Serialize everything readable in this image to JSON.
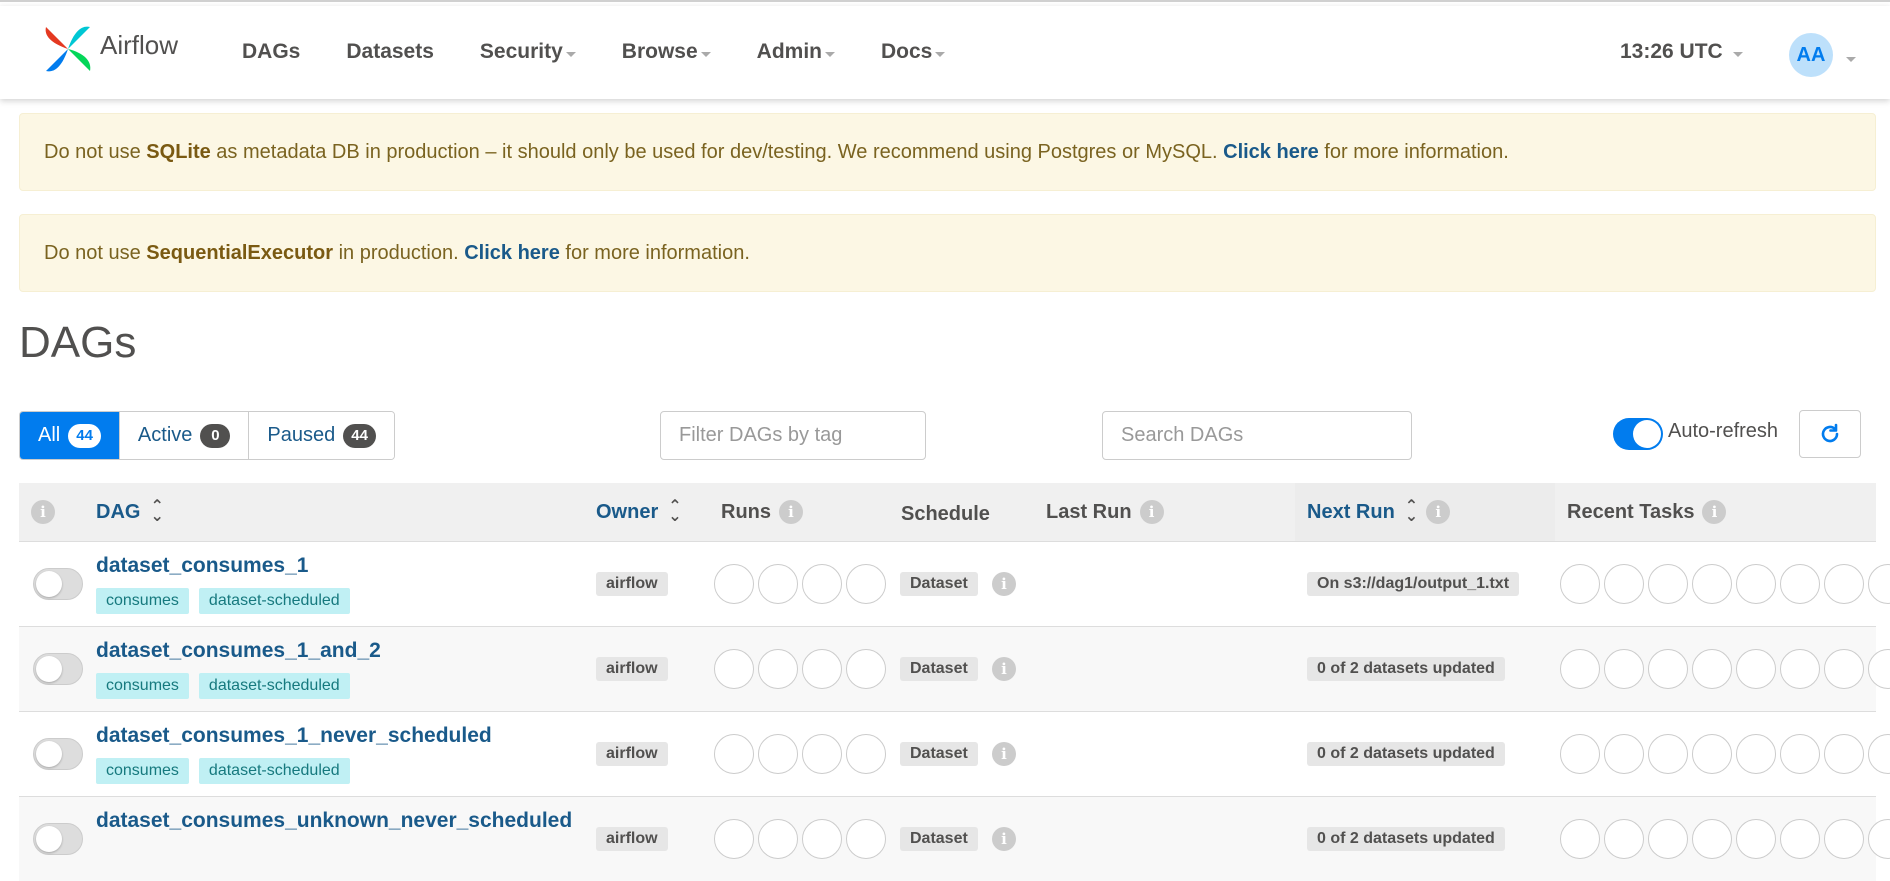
{
  "app": {
    "name": "Airflow"
  },
  "nav": {
    "items": [
      {
        "label": "DAGs",
        "dropdown": false
      },
      {
        "label": "Datasets",
        "dropdown": false
      },
      {
        "label": "Security",
        "dropdown": true
      },
      {
        "label": "Browse",
        "dropdown": true
      },
      {
        "label": "Admin",
        "dropdown": true
      },
      {
        "label": "Docs",
        "dropdown": true
      }
    ],
    "time": "13:26 UTC",
    "avatar_initials": "AA"
  },
  "alerts": {
    "sqlite": {
      "prefix": "Do not use ",
      "bold": "SQLite",
      "middle": " as metadata DB in production – it should only be used for dev/testing. We recommend using Postgres or MySQL. ",
      "link": "Click here",
      "suffix": " for more information."
    },
    "executor": {
      "prefix": "Do not use ",
      "bold": "SequentialExecutor",
      "middle": " in production. ",
      "link": "Click here",
      "suffix": " for more information."
    }
  },
  "page": {
    "title": "DAGs"
  },
  "status_filter": {
    "all": {
      "label": "All",
      "count": "44"
    },
    "active": {
      "label": "Active",
      "count": "0"
    },
    "paused": {
      "label": "Paused",
      "count": "44"
    }
  },
  "tag_filter": {
    "placeholder": "Filter DAGs by tag"
  },
  "search": {
    "placeholder": "Search DAGs"
  },
  "auto_refresh": {
    "label": "Auto-refresh",
    "enabled": true
  },
  "table": {
    "headers": {
      "dag": "DAG",
      "owner": "Owner",
      "runs": "Runs",
      "schedule": "Schedule",
      "last_run": "Last Run",
      "next_run": "Next Run",
      "recent_tasks": "Recent Tasks"
    },
    "rows": [
      {
        "name": "dataset_consumes_1",
        "tags": [
          "consumes",
          "dataset-scheduled"
        ],
        "owner": "airflow",
        "schedule": "Dataset",
        "next_run": "On s3://dag1/output_1.txt"
      },
      {
        "name": "dataset_consumes_1_and_2",
        "tags": [
          "consumes",
          "dataset-scheduled"
        ],
        "owner": "airflow",
        "schedule": "Dataset",
        "next_run": "0 of 2 datasets updated"
      },
      {
        "name": "dataset_consumes_1_never_scheduled",
        "tags": [
          "consumes",
          "dataset-scheduled"
        ],
        "owner": "airflow",
        "schedule": "Dataset",
        "next_run": "0 of 2 datasets updated"
      },
      {
        "name": "dataset_consumes_unknown_never_scheduled",
        "tags": [],
        "owner": "airflow",
        "schedule": "Dataset",
        "next_run": "0 of 2 datasets updated"
      }
    ]
  }
}
